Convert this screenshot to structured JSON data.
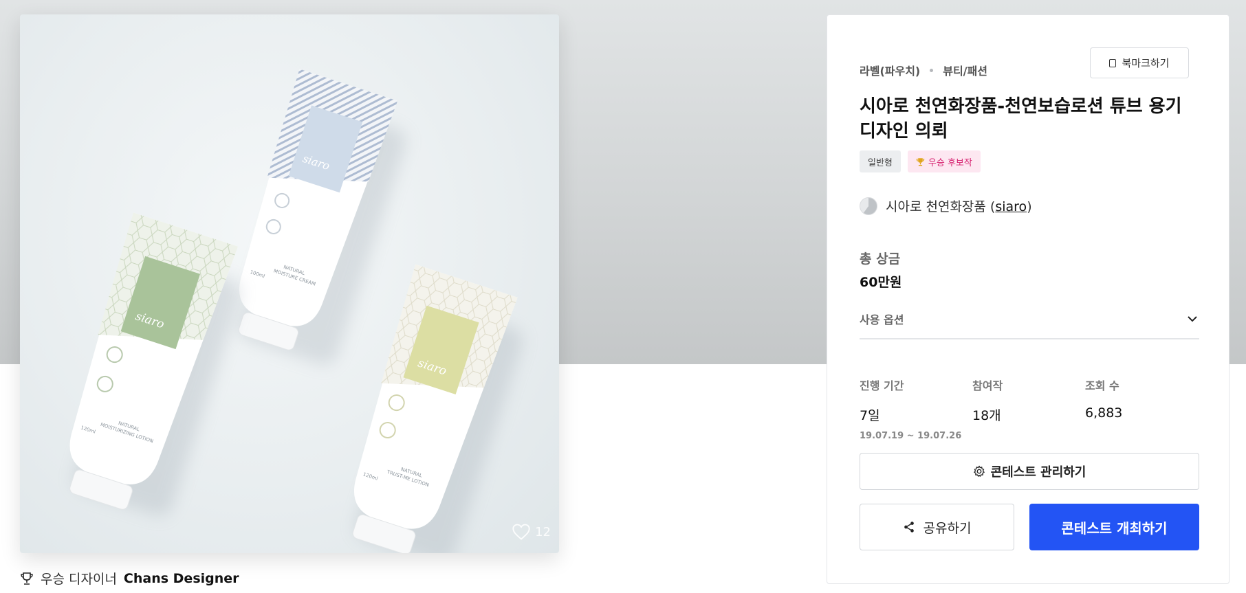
{
  "category": {
    "primary": "라벨(파우치)",
    "secondary": "뷰티/패션"
  },
  "bookmark": {
    "label": "북마크하기",
    "icon": "bookmark-icon"
  },
  "contest": {
    "title": "시아로 천연화장품-천연보습로션 튜브 용기 디자인 의뢰",
    "badges": {
      "type": "일반형",
      "winner": "우승 후보작"
    }
  },
  "host": {
    "name": "시아로 천연화장품 (",
    "handle": "siaro",
    "suffix": ")"
  },
  "prize": {
    "label": "총 상금",
    "value": "60만원"
  },
  "options": {
    "label": "사용 옵션",
    "icon": "chevron-down-icon"
  },
  "stats": {
    "period": {
      "label": "진행 기간",
      "value": "7일",
      "range": "19.07.19 ~ 19.07.26"
    },
    "entries": {
      "label": "참여작",
      "value": "18개"
    },
    "views": {
      "label": "조회 수",
      "value": "6,883"
    }
  },
  "actions": {
    "manage": "콘테스트 관리하기",
    "share": "공유하기",
    "host": "콘테스트 개최하기"
  },
  "artwork": {
    "likes": "12",
    "winner_prefix": "우승 디자이너",
    "winner_name": "Chans Designer",
    "brand_text": "siaro",
    "tube_texts": {
      "blue": {
        "brand": "siaro",
        "product": "NATURAL MOISTURE CREAM",
        "volume": "100ml"
      },
      "green": {
        "brand": "siaro",
        "product": "NATURAL MOISTURIZING LOTION",
        "volume": "120ml"
      },
      "yellow": {
        "brand": "siaro",
        "product": "NATURAL TRUST-ME LOTION",
        "volume": "120ml"
      }
    }
  },
  "colors": {
    "accent": "#2354f4",
    "winner_badge": "#d6206f"
  }
}
